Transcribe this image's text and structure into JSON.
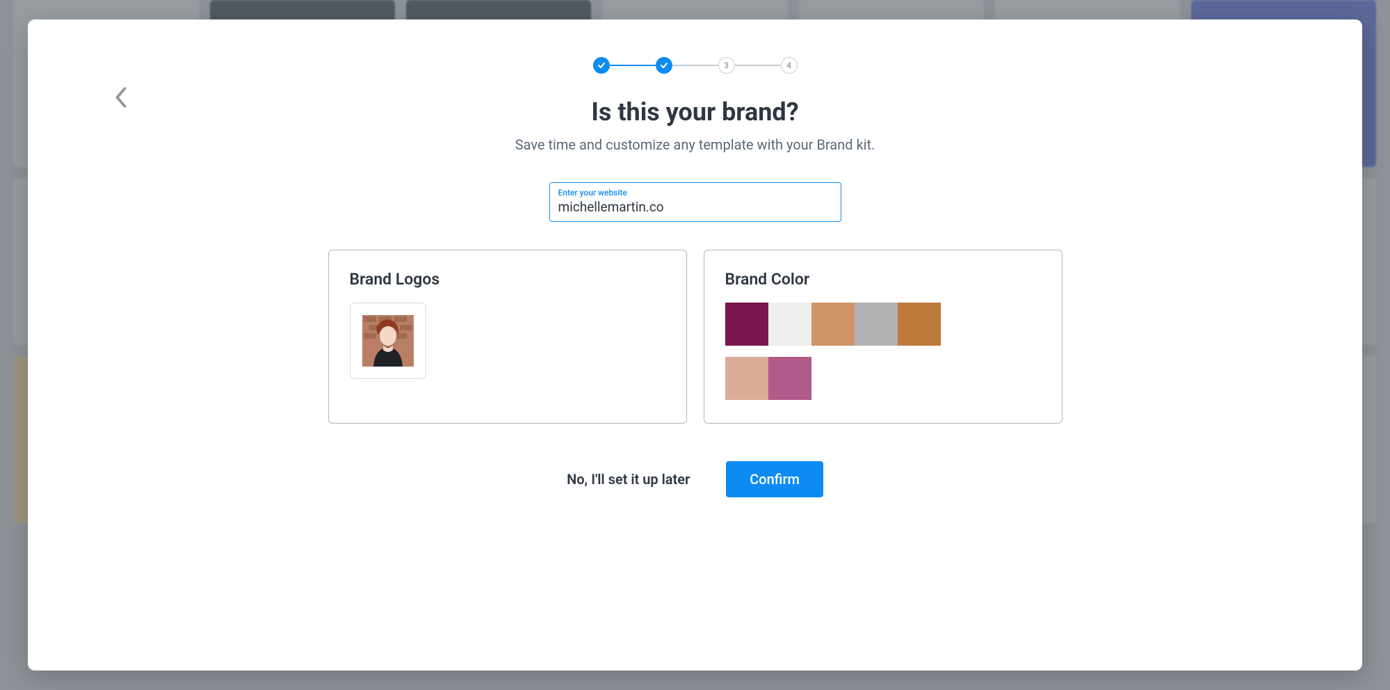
{
  "stepper": {
    "steps": [
      {
        "state": "done",
        "label": ""
      },
      {
        "state": "done",
        "label": ""
      },
      {
        "state": "todo",
        "label": "3"
      },
      {
        "state": "todo",
        "label": "4"
      }
    ]
  },
  "heading": {
    "title": "Is this your brand?",
    "subtitle": "Save time and customize any template with your Brand kit."
  },
  "website_field": {
    "label": "Enter your website",
    "value": "michellemartin.co"
  },
  "logos_panel": {
    "title": "Brand Logos"
  },
  "colors_panel": {
    "title": "Brand Color",
    "rows": [
      [
        "#7a1650",
        "#efefef",
        "#cf9367",
        "#b0b2b4",
        "#be7a3d"
      ],
      [
        "#d9ae97",
        "#b05b89"
      ]
    ]
  },
  "footer": {
    "skip_label": "No, I'll set it up later",
    "confirm_label": "Confirm"
  }
}
